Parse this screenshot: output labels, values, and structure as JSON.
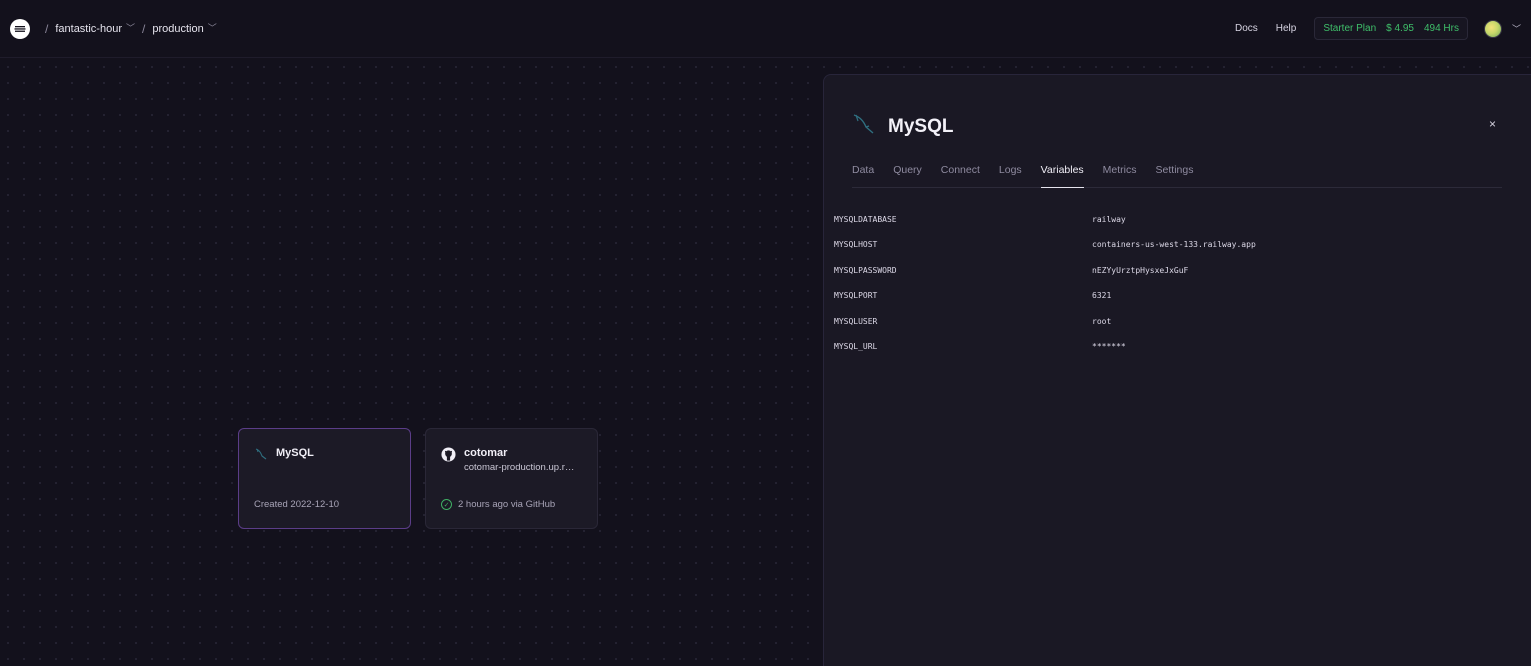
{
  "topbar": {
    "project": "fantastic-hour",
    "environment": "production",
    "links": [
      "Docs",
      "Help"
    ],
    "plan": {
      "name": "Starter Plan",
      "cost": "$ 4.95",
      "hours": "494 Hrs"
    }
  },
  "canvas": {
    "services": [
      {
        "name": "MySQL",
        "footer": "Created 2022-12-10",
        "icon": "mysql-dolphin-icon"
      },
      {
        "name": "cotomar",
        "url": "cotomar-production.up.railw...",
        "footer": "2 hours ago via GitHub",
        "icon": "github-icon",
        "status_icon": "check-circle-icon"
      }
    ]
  },
  "panel": {
    "title": "MySQL",
    "close_label": "×",
    "tabs": [
      "Data",
      "Query",
      "Connect",
      "Logs",
      "Variables",
      "Metrics",
      "Settings"
    ],
    "active_tab": "Variables",
    "variables": [
      {
        "key": "MYSQLDATABASE",
        "value": "railway"
      },
      {
        "key": "MYSQLHOST",
        "value": "containers-us-west-133.railway.app"
      },
      {
        "key": "MYSQLPASSWORD",
        "value": "nEZYyUrztpHysxeJxGuF"
      },
      {
        "key": "MYSQLPORT",
        "value": "6321"
      },
      {
        "key": "MYSQLUSER",
        "value": "root"
      },
      {
        "key": "MYSQL_URL",
        "value": "*******"
      }
    ]
  },
  "colors": {
    "accent_green": "#3fbf6a",
    "selected_border": "#5b3d88",
    "background": "#13111c"
  }
}
